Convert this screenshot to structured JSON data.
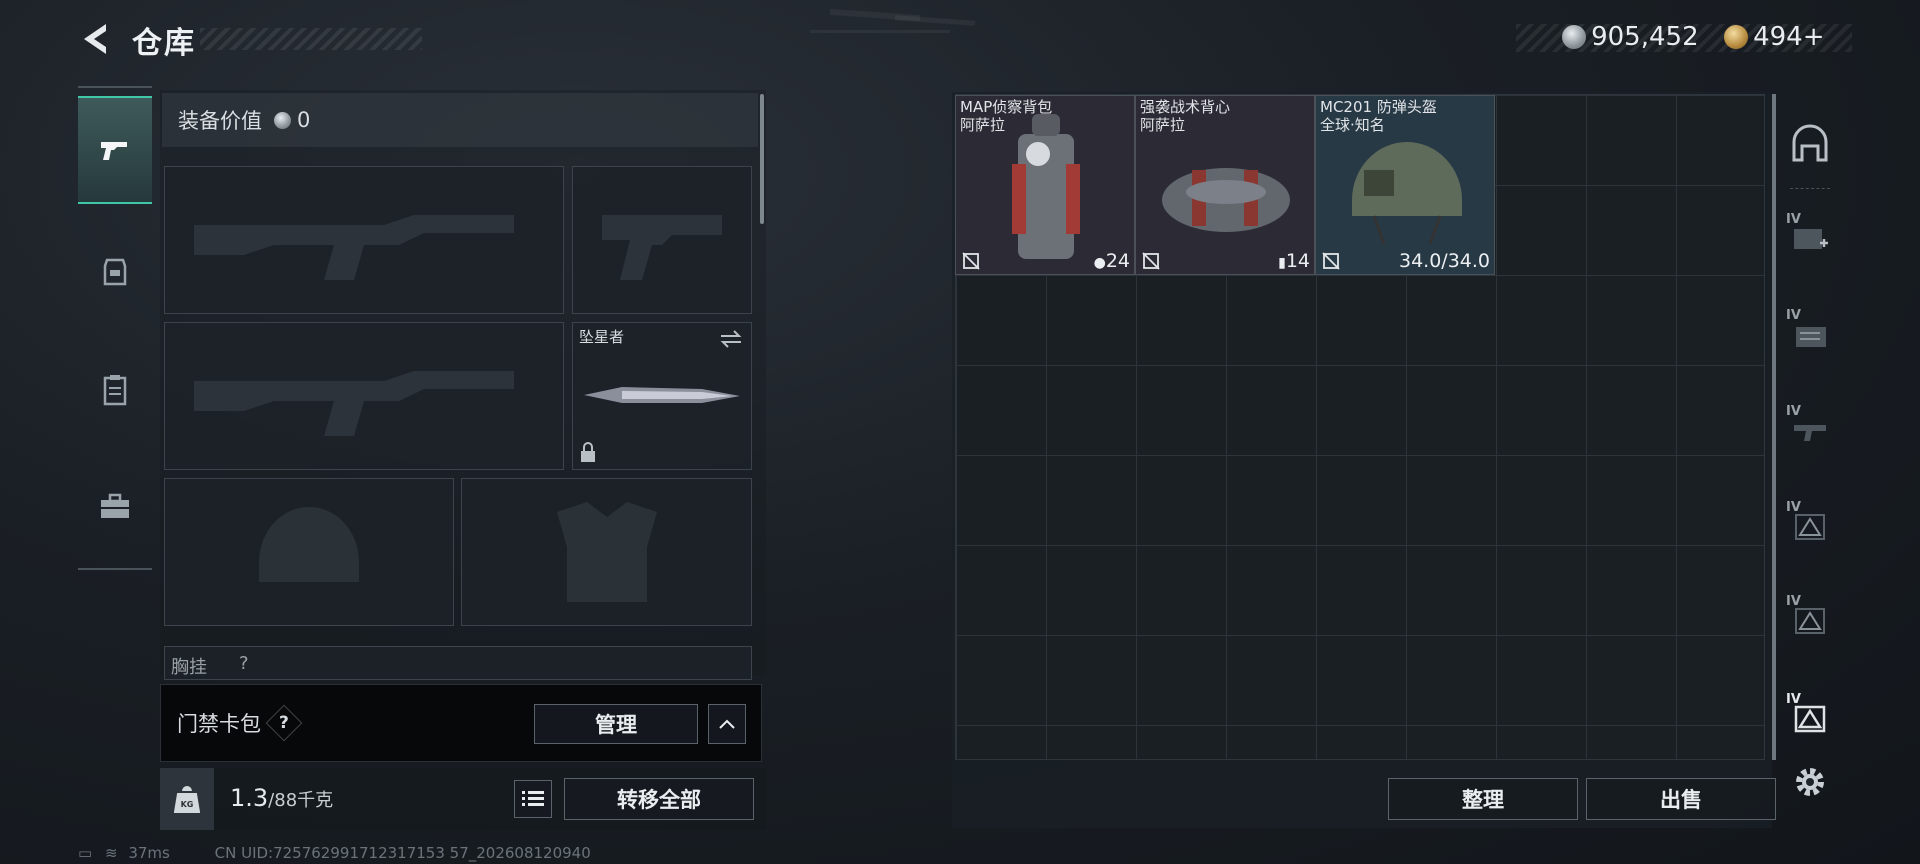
{
  "header": {
    "title": "仓库",
    "currency": [
      {
        "name": "silver-coin",
        "value": "905,452"
      },
      {
        "name": "gold-coin",
        "value": "494",
        "suffix": "+"
      }
    ]
  },
  "tabs": [
    {
      "name": "weapon-tab",
      "icon": "pistol-icon",
      "active": true
    },
    {
      "name": "armor-tab",
      "icon": "armor-vest-icon",
      "active": false
    },
    {
      "name": "clipboard-tab",
      "icon": "clipboard-icon",
      "active": false
    },
    {
      "name": "toolbox-tab",
      "icon": "toolbox-icon",
      "active": false
    }
  ],
  "equipment": {
    "value_label": "装备价值",
    "value": "0",
    "melee_name": "坠星者",
    "chest_label": "胸挂",
    "chest_hint": "?",
    "card_pack_label": "门禁卡包",
    "help": "?",
    "manage_label": "管理",
    "weight": "1.3",
    "weight_max": "/88千克",
    "transfer_all_label": "转移全部"
  },
  "stash": {
    "items": [
      {
        "name_line1": "MAP侦察背包",
        "name_line2": "阿萨拉",
        "stat": "24",
        "stat_icon": "capacity-icon"
      },
      {
        "name_line1": "强袭战术背心",
        "name_line2": "阿萨拉",
        "stat": "14",
        "stat_icon": "slots-icon"
      },
      {
        "name_line1": "MC201 防弹头盔",
        "name_line2": "全球·知名",
        "stat": "34.0/34.0",
        "stat_icon": "durability-icon"
      }
    ],
    "sort_label": "整理",
    "sell_label": "出售"
  },
  "sidebar": [
    {
      "name": "stash-home-icon",
      "tier": ""
    },
    {
      "name": "medkit-category-icon",
      "tier": "IV"
    },
    {
      "name": "files-category-icon",
      "tier": "IV"
    },
    {
      "name": "weapon-category-icon",
      "tier": "IV"
    },
    {
      "name": "hazard-category-icon-1",
      "tier": "IV"
    },
    {
      "name": "hazard-category-icon-2",
      "tier": "IV"
    },
    {
      "name": "hazard-category-icon-3",
      "tier": "IV"
    },
    {
      "name": "settings-gear-icon",
      "tier": ""
    }
  ],
  "status": {
    "ping": "37ms",
    "uid": "CN UID:725762991712317153 57_202608120940"
  },
  "colors": {
    "accent": "#3ec8a8",
    "panel": "#1a1f24"
  }
}
